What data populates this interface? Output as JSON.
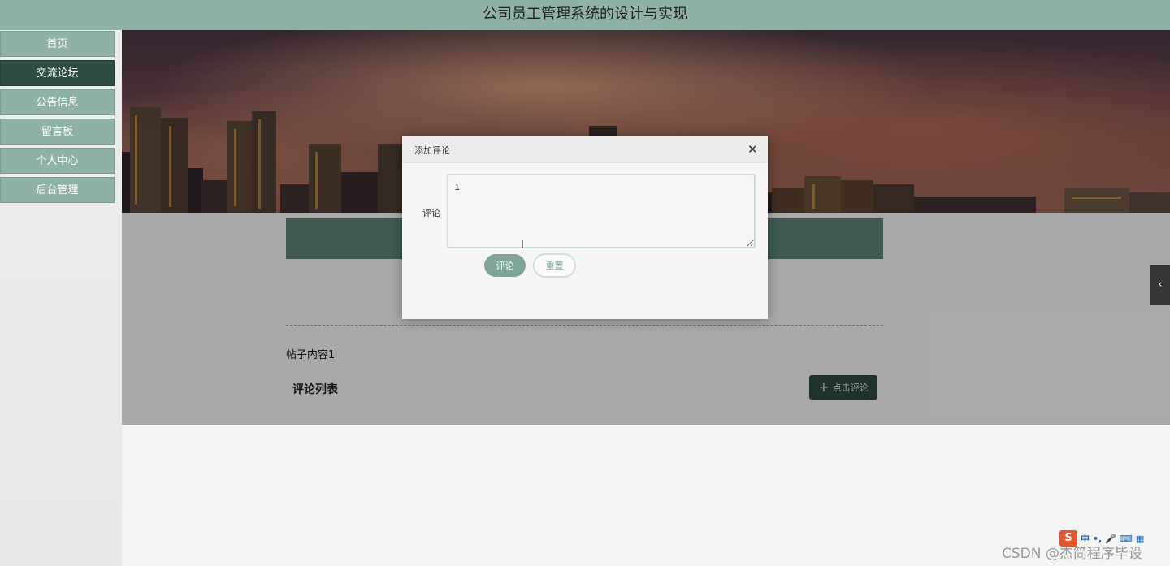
{
  "app": {
    "title": "公司员工管理系统的设计与实现"
  },
  "sidebar": {
    "items": [
      {
        "label": "首页",
        "active": false
      },
      {
        "label": "交流论坛",
        "active": true
      },
      {
        "label": "公告信息",
        "active": false
      },
      {
        "label": "留言板",
        "active": false
      },
      {
        "label": "个人中心",
        "active": false
      },
      {
        "label": "后台管理",
        "active": false
      }
    ]
  },
  "post": {
    "content": "帖子内容1"
  },
  "comments": {
    "section_title": "评论列表",
    "add_button_label": "点击评论",
    "add_button_icon": "plus-icon"
  },
  "dialog": {
    "title": "添加评论",
    "close_icon": "close-icon",
    "field_label": "评论",
    "textarea_value": "1",
    "submit_label": "评论",
    "reset_label": "重置"
  },
  "side_toggle": {
    "icon": "chevron-left-icon"
  },
  "ime": {
    "logo": "S",
    "items": [
      "中",
      "•,",
      "🎤",
      "⌨",
      "▦"
    ]
  },
  "watermark": "CSDN @杰简程序毕设",
  "colors": {
    "accent": "#8fb1a6",
    "accent_dark": "#2f4d45",
    "title_bar": "#5d8676",
    "submit": "#7fa598"
  }
}
